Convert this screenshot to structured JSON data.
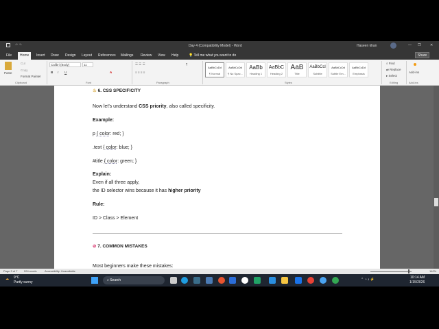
{
  "titlebar": {
    "title": "Day 4 (Compatibility Model) - Word",
    "user": "Haseen khan"
  },
  "tabs": [
    "File",
    "Home",
    "Insert",
    "Draw",
    "Design",
    "Layout",
    "References",
    "Mailings",
    "Review",
    "View",
    "Help"
  ],
  "tell_me": "Tell me what you want to do",
  "share": "Share",
  "ribbon": {
    "clipboard": {
      "paste": "Paste",
      "cut": "Cut",
      "copy": "Copy",
      "format_painter": "Format Painter",
      "label": "Clipboard"
    },
    "font": {
      "name": "Calibri (Body)",
      "size": "11",
      "label": "Font"
    },
    "paragraph": {
      "label": "Paragraph"
    },
    "styles": {
      "items": [
        {
          "sample": "AaBbCcDd",
          "name": "¶ Normal"
        },
        {
          "sample": "AaBbCcDd",
          "name": "¶ No Spac..."
        },
        {
          "sample": "AaBb",
          "name": "Heading 1"
        },
        {
          "sample": "AaBbC",
          "name": "Heading 2"
        },
        {
          "sample": "AaB",
          "name": "Title"
        },
        {
          "sample": "AaBbCcl",
          "name": "Subtitle"
        },
        {
          "sample": "AaBbCcDd",
          "name": "Subtle Em..."
        },
        {
          "sample": "AaBbCcDd",
          "name": "Emphasis"
        }
      ],
      "label": "Styles"
    },
    "editing": {
      "find": "Find",
      "replace": "Replace",
      "select": "Select",
      "label": "Editing"
    },
    "addins": {
      "button": "Add-ins",
      "label": "Add-ins"
    }
  },
  "document": {
    "heading6": "6. CSS SPECIFICITY",
    "intro_a": "Now let's understand ",
    "intro_b": "CSS priority",
    "intro_c": ", also called specificity.",
    "example": "Example:",
    "code1_a": "p ",
    "code1_b": "{ color",
    "code1_c": ": red; }",
    "code2_a": ".text ",
    "code2_b": "{ color",
    "code2_c": ": blue; }",
    "code3_a": "#title ",
    "code3_b": "{ color",
    "code3_c": ": green; }",
    "explain": "Explain:",
    "explain1": "Even if all three apply,",
    "explain2_a": "the ID selector wins because it has ",
    "explain2_b": "higher priority",
    ".": ".",
    "rule": "Rule:",
    "rule_text": "ID > Class > Element",
    "heading7": "7. COMMON MISTAKES",
    "partial": "Most beginners make these mistakes:"
  },
  "status": {
    "page": "Page 3 of 7",
    "words": "524 words",
    "accessibility": "Accessibility: Unavailable",
    "zoom": "140%"
  },
  "taskbar": {
    "temp": "9°C",
    "weather": "Partly sunny",
    "search": "Search",
    "time": "10:14 AM",
    "date": "1/15/2026"
  }
}
